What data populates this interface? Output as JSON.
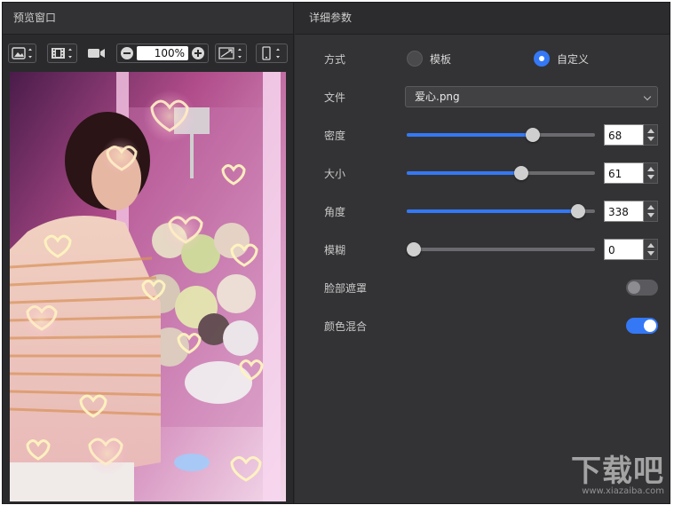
{
  "left_panel": {
    "title": "预览窗口",
    "zoom": "100%"
  },
  "right_panel": {
    "title": "详细参数",
    "mode": {
      "label": "方式",
      "options": [
        "模板",
        "自定义"
      ],
      "selected": "自定义"
    },
    "file": {
      "label": "文件",
      "value": "爱心.png"
    },
    "sliders": [
      {
        "label": "密度",
        "value": "68",
        "fraction": 0.67
      },
      {
        "label": "大小",
        "value": "61",
        "fraction": 0.61
      },
      {
        "label": "角度",
        "value": "338",
        "fraction": 0.91
      },
      {
        "label": "模糊",
        "value": "0",
        "fraction": 0.0
      }
    ],
    "toggles": [
      {
        "label": "脸部遮罩",
        "on": false
      },
      {
        "label": "颜色混合",
        "on": true
      }
    ]
  },
  "watermark": {
    "text": "下载吧",
    "domain": "www.xiazaiba.com"
  },
  "colors": {
    "accent": "#3478f6",
    "panel_bg": "#333335"
  }
}
